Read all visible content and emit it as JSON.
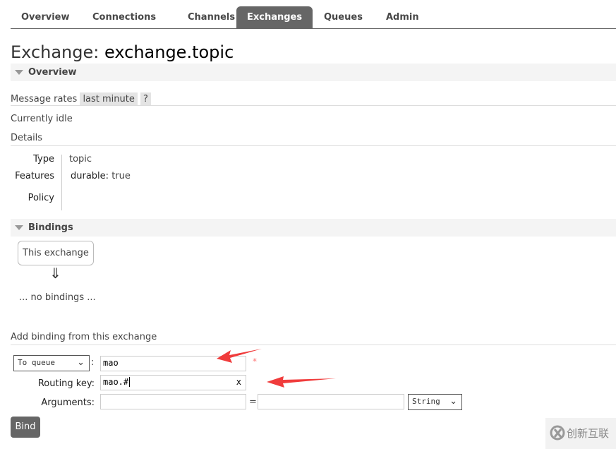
{
  "tabs": [
    "Overview",
    "Connections",
    "Channels",
    "Exchanges",
    "Queues",
    "Admin"
  ],
  "active_tab": "Exchanges",
  "title": {
    "prefix": "Exchange:",
    "name": "exchange.topic"
  },
  "overview": {
    "heading": "Overview",
    "message_rates_label": "Message rates",
    "rate_period": "last minute",
    "help": "?",
    "status": "Currently idle",
    "details_label": "Details",
    "details": [
      {
        "label": "Type",
        "value": "topic"
      },
      {
        "label": "Features",
        "key": "durable:",
        "value": "true"
      },
      {
        "label": "Policy",
        "value": ""
      }
    ]
  },
  "bindings": {
    "heading": "Bindings",
    "this_exchange": "This exchange",
    "down_arrow": "⇓",
    "none": "... no bindings ..."
  },
  "add_binding": {
    "heading": "Add binding from this exchange",
    "destination_type": "To queue",
    "destination_value": "mao",
    "required_mark": "*",
    "routing_key_label": "Routing key:",
    "routing_key_value": "mao.#",
    "clear": "x",
    "arguments_label": "Arguments:",
    "arg_key": "",
    "arg_value": "",
    "equals": "=",
    "arg_type": "String",
    "bind_button": "Bind"
  },
  "watermark": "创新互联",
  "colors": {
    "active_tab": "#666666",
    "annotation_arrow": "#f03c3c"
  }
}
